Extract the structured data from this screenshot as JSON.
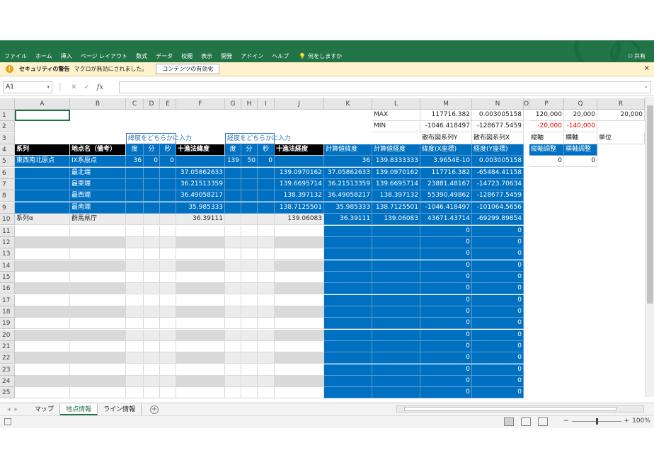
{
  "ribbon": {
    "tabs": [
      "ファイル",
      "ホーム",
      "挿入",
      "ページ レイアウト",
      "数式",
      "データ",
      "校閲",
      "表示",
      "開発",
      "アドイン",
      "ヘルプ"
    ],
    "tell_me": "何をしますか",
    "share": "共有",
    "colors": {
      "ribbon_bg": "#227447",
      "accent": "#217346"
    }
  },
  "security": {
    "title": "セキュリティの警告",
    "message": "マクロが無効にされました。",
    "enable_button": "コンテンツの有効化",
    "close": "×"
  },
  "formula_bar": {
    "name_box": "A1",
    "formula": ""
  },
  "columns": [
    "A",
    "B",
    "C",
    "D",
    "E",
    "F",
    "G",
    "H",
    "I",
    "J",
    "K",
    "L",
    "M",
    "N",
    "O",
    "P",
    "Q",
    "R"
  ],
  "rows": [
    "1",
    "2",
    "3",
    "4",
    "5",
    "6",
    "7",
    "8",
    "9",
    "10",
    "11",
    "12",
    "13",
    "14",
    "15",
    "16",
    "17",
    "18",
    "19",
    "20",
    "21",
    "22",
    "23",
    "24",
    "25"
  ],
  "sheet": {
    "r1": {
      "L": "MAX",
      "M": "117716.382",
      "N": "0.003005158",
      "P": "120,000",
      "Q": "20,000",
      "R": "20,000"
    },
    "r2": {
      "L": "MIN",
      "M": "-1046.418497",
      "N": "-128677.5459",
      "P": "-20,000",
      "Q": "-140,000"
    },
    "r3": {
      "CDE": "緯度をどちらかに入力",
      "GHI": "経度をどちらかに入力",
      "M": "散布図系列Y",
      "N": "散布図系列X",
      "P": "縦軸",
      "Q": "横軸",
      "R": "単位"
    },
    "r4": {
      "A": "系列",
      "B": "地点名（備考）",
      "C": "度",
      "D": "分",
      "E": "秒",
      "F": "十進法緯度",
      "G": "度",
      "H": "分",
      "I": "秒",
      "J": "十進法経度",
      "K": "計算値緯度",
      "L": "計算値経度",
      "M": "緯度(X座標)",
      "N": "経度(Y座標)",
      "P": "縦軸調整",
      "Q": "横軸調整"
    },
    "r5": {
      "A": "東西南北原点",
      "B": "IX系原点",
      "C": "36",
      "D": "0",
      "E": "0",
      "G": "139",
      "H": "50",
      "I": "0",
      "K": "36",
      "L": "139.8333333",
      "M": "3.9654E-10",
      "N": "0.003005158",
      "P": "0",
      "Q": "0"
    },
    "r6": {
      "B": "最北端",
      "F": "37.05862633",
      "J": "139.0970162",
      "K": "37.05862633",
      "L": "139.0970162",
      "M": "117716.382",
      "N": "-65484.41158"
    },
    "r7": {
      "B": "最東端",
      "F": "36.21513359",
      "J": "139.6695714",
      "K": "36.21513359",
      "L": "139.6695714",
      "M": "23881.48167",
      "N": "-14723.70634"
    },
    "r8": {
      "B": "最西端",
      "F": "36.49058217",
      "J": "138.397132",
      "K": "36.49058217",
      "L": "138.397132",
      "M": "55390.49862",
      "N": "-128677.5459"
    },
    "r9": {
      "B": "最南端",
      "F": "35.985333",
      "J": "138.7125501",
      "K": "35.985333",
      "L": "138.7125501",
      "M": "-1046.418497",
      "N": "-101064.5656"
    },
    "r10": {
      "A": "系列α",
      "B": "群馬県庁",
      "F": "36.39111",
      "J": "139.06083",
      "K": "36.39111",
      "L": "139.06083",
      "M": "43671.43714",
      "N": "-69299.89854"
    },
    "zero": "0"
  },
  "sheet_tabs": [
    "マップ",
    "地点情報",
    "ライン情報"
  ],
  "active_tab": "地点情報",
  "status": {
    "zoom": "100%"
  }
}
